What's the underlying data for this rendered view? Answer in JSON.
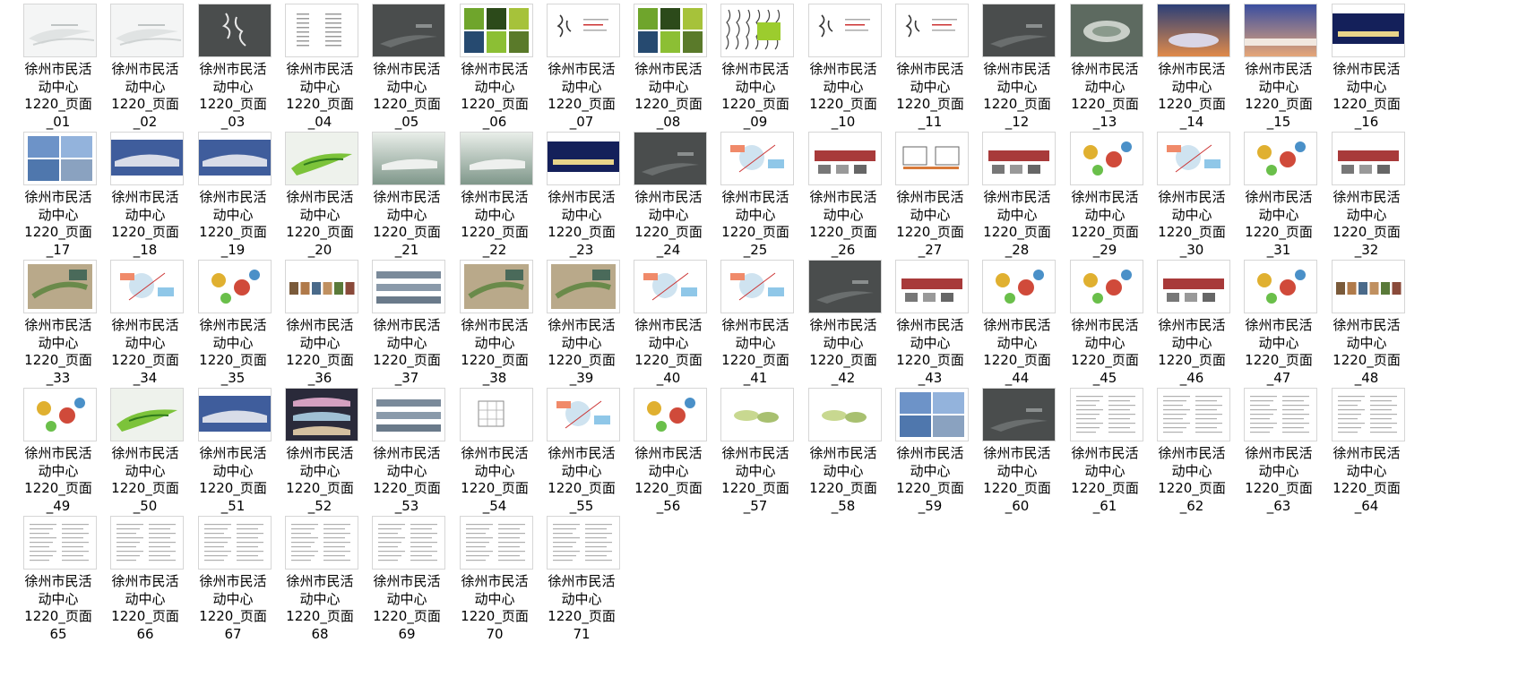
{
  "thumbnail_view": {
    "file_base_name": "徐州市民活动中心",
    "files": [
      {
        "name_line1": "徐州市民活",
        "name_line2": "动中心",
        "name_line3": "1220_页面",
        "name_line4": "_01",
        "preview": "cover-light"
      },
      {
        "name_line1": "徐州市民活",
        "name_line2": "动中心",
        "name_line3": "1220_页面",
        "name_line4": "_02",
        "preview": "cover-light"
      },
      {
        "name_line1": "徐州市民活",
        "name_line2": "动中心",
        "name_line3": "1220_页面",
        "name_line4": "_03",
        "preview": "dark-calligraphy"
      },
      {
        "name_line1": "徐州市民活",
        "name_line2": "动中心",
        "name_line3": "1220_页面",
        "name_line4": "_04",
        "preview": "contents"
      },
      {
        "name_line1": "徐州市民活",
        "name_line2": "动中心",
        "name_line3": "1220_页面",
        "name_line4": "_05",
        "preview": "dark-section"
      },
      {
        "name_line1": "徐州市民活",
        "name_line2": "动中心",
        "name_line3": "1220_页面",
        "name_line4": "_06",
        "preview": "photo-grid-green"
      },
      {
        "name_line1": "徐州市民活",
        "name_line2": "动中心",
        "name_line3": "1220_页面",
        "name_line4": "_07",
        "preview": "calligraphy"
      },
      {
        "name_line1": "徐州市民活",
        "name_line2": "动中心",
        "name_line3": "1220_页面",
        "name_line4": "_08",
        "preview": "photo-grid-green"
      },
      {
        "name_line1": "徐州市民活",
        "name_line2": "动中心",
        "name_line3": "1220_页面",
        "name_line4": "_09",
        "preview": "calligraphy-green"
      },
      {
        "name_line1": "徐州市民活",
        "name_line2": "动中心",
        "name_line3": "1220_页面",
        "name_line4": "_10",
        "preview": "calligraphy"
      },
      {
        "name_line1": "徐州市民活",
        "name_line2": "动中心",
        "name_line3": "1220_页面",
        "name_line4": "_11",
        "preview": "calligraphy"
      },
      {
        "name_line1": "徐州市民活",
        "name_line2": "动中心",
        "name_line3": "1220_页面",
        "name_line4": "_12",
        "preview": "dark-section"
      },
      {
        "name_line1": "徐州市民活",
        "name_line2": "动中心",
        "name_line3": "1220_页面",
        "name_line4": "_13",
        "preview": "aerial-photo"
      },
      {
        "name_line1": "徐州市民活",
        "name_line2": "动中心",
        "name_line3": "1220_页面",
        "name_line4": "_14",
        "preview": "sunset-photo"
      },
      {
        "name_line1": "徐州市民活",
        "name_line2": "动中心",
        "name_line3": "1220_页面",
        "name_line4": "_15",
        "preview": "dusk-photo"
      },
      {
        "name_line1": "徐州市民活",
        "name_line2": "动中心",
        "name_line3": "1220_页面",
        "name_line4": "_16",
        "preview": "night-photo"
      },
      {
        "name_line1": "徐州市民活",
        "name_line2": "动中心",
        "name_line3": "1220_页面",
        "name_line4": "_17",
        "preview": "photo-grid-blue"
      },
      {
        "name_line1": "徐州市民活",
        "name_line2": "动中心",
        "name_line3": "1220_页面",
        "name_line4": "_18",
        "preview": "blue-photo"
      },
      {
        "name_line1": "徐州市民活",
        "name_line2": "动中心",
        "name_line3": "1220_页面",
        "name_line4": "_19",
        "preview": "blue-photo"
      },
      {
        "name_line1": "徐州市民活",
        "name_line2": "动中心",
        "name_line3": "1220_页面",
        "name_line4": "_20",
        "preview": "green-render"
      },
      {
        "name_line1": "徐州市民活",
        "name_line2": "动中心",
        "name_line3": "1220_页面",
        "name_line4": "_21",
        "preview": "misty-render"
      },
      {
        "name_line1": "徐州市民活",
        "name_line2": "动中心",
        "name_line3": "1220_页面",
        "name_line4": "_22",
        "preview": "misty-render"
      },
      {
        "name_line1": "徐州市民活",
        "name_line2": "动中心",
        "name_line3": "1220_页面",
        "name_line4": "_23",
        "preview": "night-photo"
      },
      {
        "name_line1": "徐州市民活",
        "name_line2": "动中心",
        "name_line3": "1220_页面",
        "name_line4": "_24",
        "preview": "dark-section"
      },
      {
        "name_line1": "徐州市民活",
        "name_line2": "动中心",
        "name_line3": "1220_页面",
        "name_line4": "_25",
        "preview": "diagram-map"
      },
      {
        "name_line1": "徐州市民活",
        "name_line2": "动中心",
        "name_line3": "1220_页面",
        "name_line4": "_26",
        "preview": "diagram-red"
      },
      {
        "name_line1": "徐州市民活",
        "name_line2": "动中心",
        "name_line3": "1220_页面",
        "name_line4": "_27",
        "preview": "diagram-sections"
      },
      {
        "name_line1": "徐州市民活",
        "name_line2": "动中心",
        "name_line3": "1220_页面",
        "name_line4": "_28",
        "preview": "diagram-red"
      },
      {
        "name_line1": "徐州市民活",
        "name_line2": "动中心",
        "name_line3": "1220_页面",
        "name_line4": "_29",
        "preview": "diagram-colorful"
      },
      {
        "name_line1": "徐州市民活",
        "name_line2": "动中心",
        "name_line3": "1220_页面",
        "name_line4": "_30",
        "preview": "diagram-map"
      },
      {
        "name_line1": "徐州市民活",
        "name_line2": "动中心",
        "name_line3": "1220_页面",
        "name_line4": "_31",
        "preview": "diagram-colorful"
      },
      {
        "name_line1": "徐州市民活",
        "name_line2": "动中心",
        "name_line3": "1220_页面",
        "name_line4": "_32",
        "preview": "diagram-red"
      },
      {
        "name_line1": "徐州市民活",
        "name_line2": "动中心",
        "name_line3": "1220_页面",
        "name_line4": "_33",
        "preview": "site-plan"
      },
      {
        "name_line1": "徐州市民活",
        "name_line2": "动中心",
        "name_line3": "1220_页面",
        "name_line4": "_34",
        "preview": "diagram-map"
      },
      {
        "name_line1": "徐州市民活",
        "name_line2": "动中心",
        "name_line3": "1220_页面",
        "name_line4": "_35",
        "preview": "diagram-colorful"
      },
      {
        "name_line1": "徐州市民活",
        "name_line2": "动中心",
        "name_line3": "1220_页面",
        "name_line4": "_36",
        "preview": "photo-strip"
      },
      {
        "name_line1": "徐州市民活",
        "name_line2": "动中心",
        "name_line3": "1220_页面",
        "name_line4": "_37",
        "preview": "elevations"
      },
      {
        "name_line1": "徐州市民活",
        "name_line2": "动中心",
        "name_line3": "1220_页面",
        "name_line4": "_38",
        "preview": "site-plan"
      },
      {
        "name_line1": "徐州市民活",
        "name_line2": "动中心",
        "name_line3": "1220_页面",
        "name_line4": "_39",
        "preview": "site-plan"
      },
      {
        "name_line1": "徐州市民活",
        "name_line2": "动中心",
        "name_line3": "1220_页面",
        "name_line4": "_40",
        "preview": "diagram-map"
      },
      {
        "name_line1": "徐州市民活",
        "name_line2": "动中心",
        "name_line3": "1220_页面",
        "name_line4": "_41",
        "preview": "diagram-map"
      },
      {
        "name_line1": "徐州市民活",
        "name_line2": "动中心",
        "name_line3": "1220_页面",
        "name_line4": "_42",
        "preview": "dark-section"
      },
      {
        "name_line1": "徐州市民活",
        "name_line2": "动中心",
        "name_line3": "1220_页面",
        "name_line4": "_43",
        "preview": "diagram-red"
      },
      {
        "name_line1": "徐州市民活",
        "name_line2": "动中心",
        "name_line3": "1220_页面",
        "name_line4": "_44",
        "preview": "diagram-colorful"
      },
      {
        "name_line1": "徐州市民活",
        "name_line2": "动中心",
        "name_line3": "1220_页面",
        "name_line4": "_45",
        "preview": "diagram-colorful"
      },
      {
        "name_line1": "徐州市民活",
        "name_line2": "动中心",
        "name_line3": "1220_页面",
        "name_line4": "_46",
        "preview": "diagram-red"
      },
      {
        "name_line1": "徐州市民活",
        "name_line2": "动中心",
        "name_line3": "1220_页面",
        "name_line4": "_47",
        "preview": "diagram-colorful"
      },
      {
        "name_line1": "徐州市民活",
        "name_line2": "动中心",
        "name_line3": "1220_页面",
        "name_line4": "_48",
        "preview": "photo-strip"
      },
      {
        "name_line1": "徐州市民活",
        "name_line2": "动中心",
        "name_line3": "1220_页面",
        "name_line4": "_49",
        "preview": "diagram-colorful"
      },
      {
        "name_line1": "徐州市民活",
        "name_line2": "动中心",
        "name_line3": "1220_页面",
        "name_line4": "_50",
        "preview": "green-render"
      },
      {
        "name_line1": "徐州市民活",
        "name_line2": "动中心",
        "name_line3": "1220_页面",
        "name_line4": "_51",
        "preview": "blue-photo"
      },
      {
        "name_line1": "徐州市民活",
        "name_line2": "动中心",
        "name_line3": "1220_页面",
        "name_line4": "_52",
        "preview": "plans-dark"
      },
      {
        "name_line1": "徐州市民活",
        "name_line2": "动中心",
        "name_line3": "1220_页面",
        "name_line4": "_53",
        "preview": "elevations"
      },
      {
        "name_line1": "徐州市民活",
        "name_line2": "动中心",
        "name_line3": "1220_页面",
        "name_line4": "_54",
        "preview": "table-plan"
      },
      {
        "name_line1": "徐州市民活",
        "name_line2": "动中心",
        "name_line3": "1220_页面",
        "name_line4": "_55",
        "preview": "diagram-map"
      },
      {
        "name_line1": "徐州市民活",
        "name_line2": "动中心",
        "name_line3": "1220_页面",
        "name_line4": "_56",
        "preview": "diagram-colorful"
      },
      {
        "name_line1": "徐州市民活",
        "name_line2": "动中心",
        "name_line3": "1220_页面",
        "name_line4": "_57",
        "preview": "leaf-shapes"
      },
      {
        "name_line1": "徐州市民活",
        "name_line2": "动中心",
        "name_line3": "1220_页面",
        "name_line4": "_58",
        "preview": "leaf-shapes"
      },
      {
        "name_line1": "徐州市民活",
        "name_line2": "动中心",
        "name_line3": "1220_页面",
        "name_line4": "_59",
        "preview": "photo-grid-blue"
      },
      {
        "name_line1": "徐州市民活",
        "name_line2": "动中心",
        "name_line3": "1220_页面",
        "name_line4": "_60",
        "preview": "dark-section"
      },
      {
        "name_line1": "徐州市民活",
        "name_line2": "动中心",
        "name_line3": "1220_页面",
        "name_line4": "_61",
        "preview": "text-page"
      },
      {
        "name_line1": "徐州市民活",
        "name_line2": "动中心",
        "name_line3": "1220_页面",
        "name_line4": "_62",
        "preview": "text-page"
      },
      {
        "name_line1": "徐州市民活",
        "name_line2": "动中心",
        "name_line3": "1220_页面",
        "name_line4": "_63",
        "preview": "text-page"
      },
      {
        "name_line1": "徐州市民活",
        "name_line2": "动中心",
        "name_line3": "1220_页面",
        "name_line4": "_64",
        "preview": "text-page"
      },
      {
        "name_line1": "徐州市民活",
        "name_line2": "动中心",
        "name_line3": "1220_页面",
        "name_line4": "65",
        "preview": "text-page"
      },
      {
        "name_line1": "徐州市民活",
        "name_line2": "动中心",
        "name_line3": "1220_页面",
        "name_line4": "66",
        "preview": "text-page"
      },
      {
        "name_line1": "徐州市民活",
        "name_line2": "动中心",
        "name_line3": "1220_页面",
        "name_line4": "67",
        "preview": "text-page"
      },
      {
        "name_line1": "徐州市民活",
        "name_line2": "动中心",
        "name_line3": "1220_页面",
        "name_line4": "68",
        "preview": "text-page"
      },
      {
        "name_line1": "徐州市民活",
        "name_line2": "动中心",
        "name_line3": "1220_页面",
        "name_line4": "69",
        "preview": "text-page"
      },
      {
        "name_line1": "徐州市民活",
        "name_line2": "动中心",
        "name_line3": "1220_页面",
        "name_line4": "70",
        "preview": "text-page"
      },
      {
        "name_line1": "徐州市民活",
        "name_line2": "动中心",
        "name_line3": "1220_页面",
        "name_line4": "71",
        "preview": "text-page"
      }
    ]
  },
  "colors": {
    "background": "#ffffff",
    "label_text": "#000000",
    "thumb_border": "#d6d6d6",
    "dark_page": "#4a4d4d"
  }
}
